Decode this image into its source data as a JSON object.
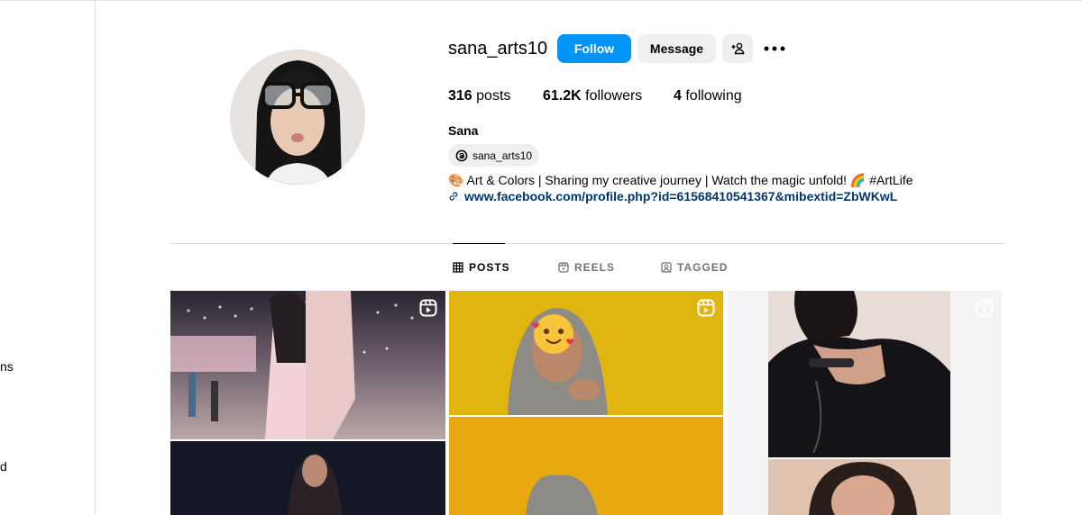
{
  "sidebar": {
    "items": [
      {
        "label": "ns"
      },
      {
        "label": "d"
      }
    ]
  },
  "profile": {
    "username": "sana_arts10",
    "follow_label": "Follow",
    "message_label": "Message",
    "stats": {
      "posts_count": "316",
      "posts_label": "posts",
      "followers_count": "61.2K",
      "followers_label": "followers",
      "following_count": "4",
      "following_label": "following"
    },
    "full_name": "Sana",
    "threads_handle": "sana_arts10",
    "bio": "🎨 Art & Colors | Sharing my creative journey | Watch the magic unfold! 🌈 #ArtLife",
    "link": "www.facebook.com/profile.php?id=61568410541367&mibextid=ZbWKwL"
  },
  "tabs": [
    {
      "label": "POSTS",
      "active": true
    },
    {
      "label": "REELS",
      "active": false
    },
    {
      "label": "TAGGED",
      "active": false
    }
  ],
  "posts": [
    {
      "type": "reel"
    },
    {
      "type": "reel"
    },
    {
      "type": "reel"
    }
  ],
  "colors": {
    "accent": "#0095f6",
    "link": "#00376b",
    "button_secondary": "#efefef",
    "muted": "#737373"
  }
}
